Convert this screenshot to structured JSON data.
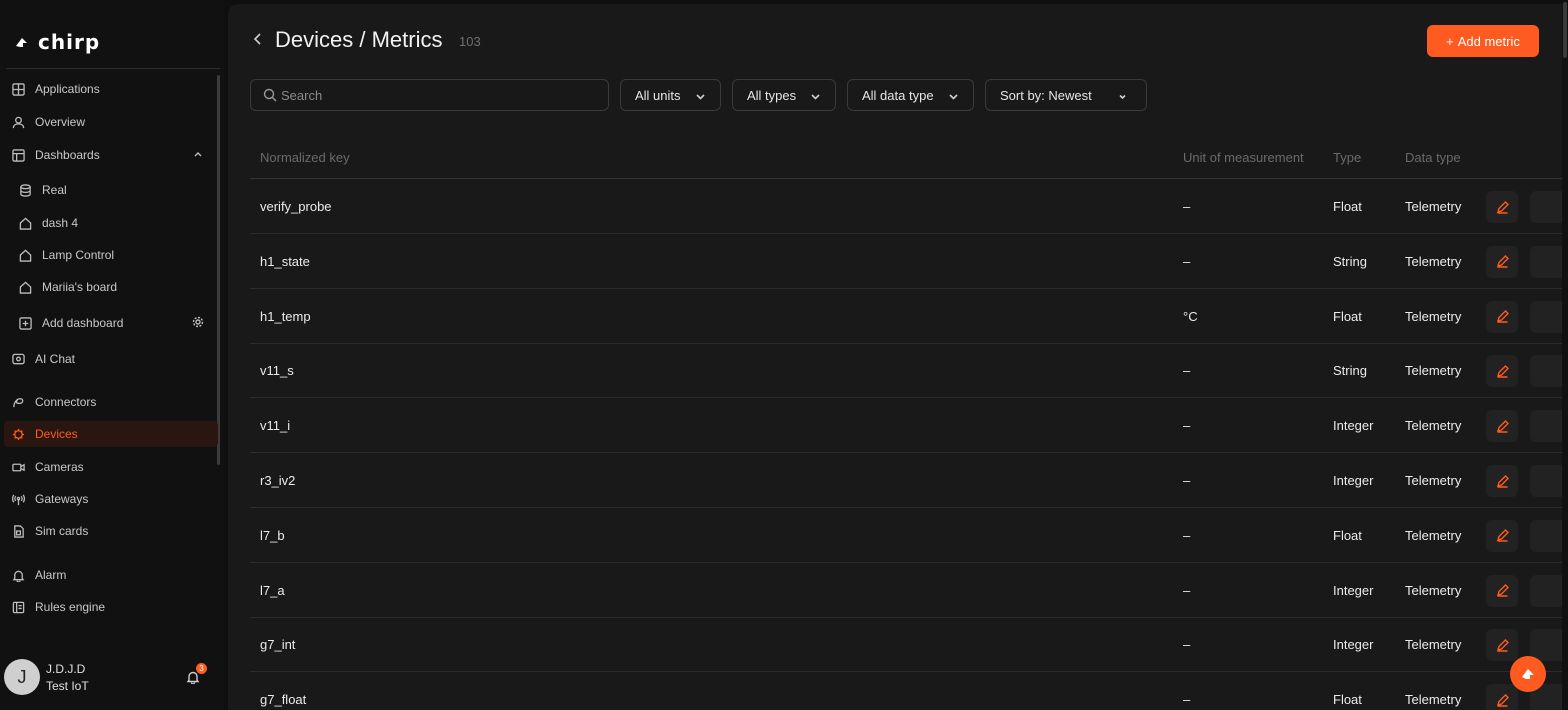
{
  "app": {
    "brand": "chirp"
  },
  "sidebar": {
    "items": [
      {
        "label": "Applications",
        "icon": "grid-icon"
      },
      {
        "label": "Overview",
        "icon": "user-icon"
      },
      {
        "label": "Dashboards",
        "icon": "dashboard-icon"
      },
      {
        "label": "Real",
        "icon": "database-icon"
      },
      {
        "label": "dash 4",
        "icon": "home-icon"
      },
      {
        "label": "Lamp Control",
        "icon": "home-icon"
      },
      {
        "label": "Mariia's board",
        "icon": "home-icon"
      },
      {
        "label": "Add dashboard",
        "icon": "plus-square-icon"
      },
      {
        "label": "AI Chat",
        "icon": "ai-chat-icon"
      },
      {
        "label": "Connectors",
        "icon": "connector-icon"
      },
      {
        "label": "Devices",
        "icon": "device-icon"
      },
      {
        "label": "Cameras",
        "icon": "camera-icon"
      },
      {
        "label": "Gateways",
        "icon": "gateway-icon"
      },
      {
        "label": "Sim cards",
        "icon": "sim-icon"
      },
      {
        "label": "Alarm",
        "icon": "bell-icon"
      },
      {
        "label": "Rules engine",
        "icon": "rules-icon"
      }
    ],
    "user": {
      "initial": "J",
      "name": "J.D.J.D",
      "org": "Test IoT",
      "notifications": "3"
    }
  },
  "header": {
    "title": "Devices / Metrics",
    "count": "103",
    "add_label": "Add metric"
  },
  "filters": {
    "search_placeholder": "Search",
    "units": "All units",
    "types": "All types",
    "data_type": "All data type",
    "sort": "Sort by: Newest"
  },
  "table": {
    "columns": [
      "Normalized key",
      "Unit of measurement",
      "Type",
      "Data type"
    ],
    "rows": [
      {
        "key": "verify_probe",
        "unit": "–",
        "type": "Float",
        "data_type": "Telemetry"
      },
      {
        "key": "h1_state",
        "unit": "–",
        "type": "String",
        "data_type": "Telemetry"
      },
      {
        "key": "h1_temp",
        "unit": "°C",
        "type": "Float",
        "data_type": "Telemetry"
      },
      {
        "key": "v11_s",
        "unit": "–",
        "type": "String",
        "data_type": "Telemetry"
      },
      {
        "key": "v11_i",
        "unit": "–",
        "type": "Integer",
        "data_type": "Telemetry"
      },
      {
        "key": "r3_iv2",
        "unit": "–",
        "type": "Integer",
        "data_type": "Telemetry"
      },
      {
        "key": "l7_b",
        "unit": "–",
        "type": "Float",
        "data_type": "Telemetry"
      },
      {
        "key": "l7_a",
        "unit": "–",
        "type": "Integer",
        "data_type": "Telemetry"
      },
      {
        "key": "g7_int",
        "unit": "–",
        "type": "Integer",
        "data_type": "Telemetry"
      },
      {
        "key": "g7_float",
        "unit": "–",
        "type": "Float",
        "data_type": "Telemetry"
      }
    ]
  },
  "colors": {
    "accent": "#ff5a1f",
    "background": "#191919",
    "sidebar": "#111111"
  }
}
